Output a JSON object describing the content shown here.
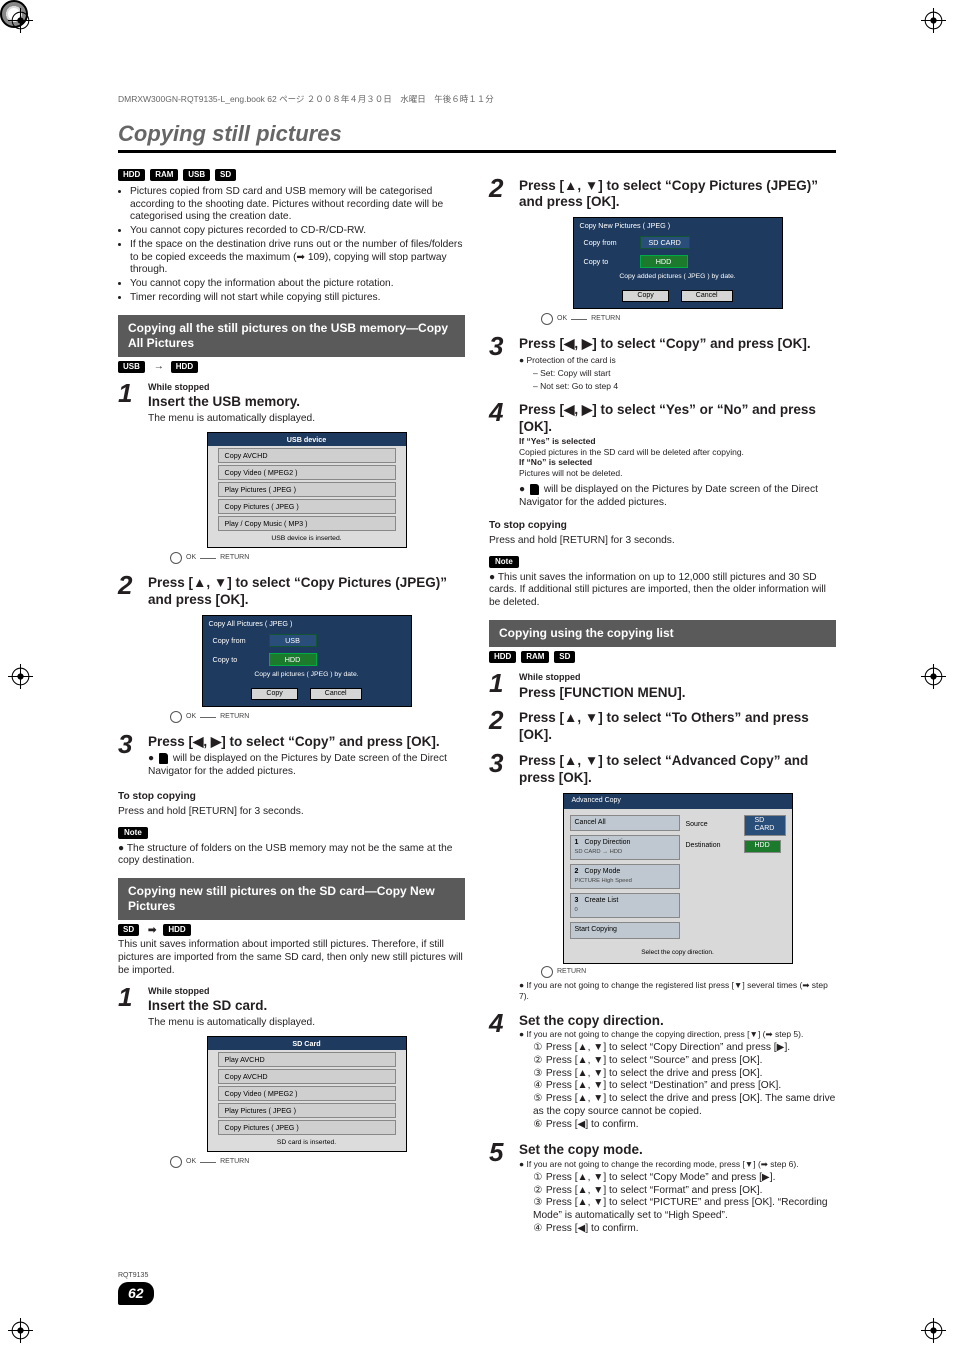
{
  "folio": "DMRXW300GN-RQT9135-L_eng.book  62 ページ  ２００８年４月３０日　水曜日　午後６時１１分",
  "page_number": "62",
  "rqt": "RQT9135",
  "title": "Copying still pictures",
  "media_badges": [
    "HDD",
    "RAM",
    "USB",
    "SD"
  ],
  "intro_bullets": [
    "Pictures copied from SD card and USB memory will be categorised according to the shooting date. Pictures without recording date will be categorised using the creation date.",
    "You cannot copy pictures recorded to CD-R/CD-RW.",
    "If the space on the destination drive runs out or the number of files/folders to be copied exceeds the maximum (➡ 109), copying will stop partway through.",
    "You cannot copy the information about the picture rotation.",
    "Timer recording will not start while copying still pictures."
  ],
  "section_a": {
    "heading": "Copying all the still pictures on the USB memory—Copy All Pictures",
    "path_from": "USB",
    "path_arrow": "→",
    "path_to": "HDD",
    "step1_lead": "While stopped",
    "step1_head": "Insert the USB memory.",
    "step1_sub": "The menu is automatically displayed.",
    "ui_usb": {
      "title": "USB device",
      "items": [
        "Copy AVCHD",
        "Copy Video ( MPEG2 )",
        "Play Pictures ( JPEG )",
        "Copy Pictures ( JPEG )",
        "Play / Copy Music ( MP3 )"
      ],
      "msg": "USB device is inserted.",
      "foot_ok": "OK",
      "foot_return": "RETURN"
    },
    "step2_head": "Press [▲, ▼] to select “Copy Pictures (JPEG)” and press [OK].",
    "ui_copyall": {
      "title": "Copy All Pictures ( JPEG )",
      "from_lbl": "Copy from",
      "from_val": "USB",
      "to_lbl": "Copy to",
      "to_val": "HDD",
      "msg": "Copy all pictures ( JPEG ) by date.",
      "btn_copy": "Copy",
      "btn_cancel": "Cancel",
      "foot_ok": "OK",
      "foot_return": "RETURN"
    },
    "step3_head": "Press [◀, ▶] to select “Copy” and press [OK].",
    "step3_note": "will be displayed on the Pictures by Date screen of the Direct Navigator for the added pictures.",
    "stop_head": "To stop copying",
    "stop_body": "Press and hold [RETURN] for 3 seconds.",
    "note_label": "Note",
    "note_text": "The structure of folders on the USB memory may not be the same at the copy destination."
  },
  "section_b": {
    "heading": "Copying new still pictures on the SD card—Copy New Pictures",
    "path_from": "SD",
    "path_arrow": "➡",
    "path_to": "HDD",
    "intro": "This unit saves information about imported still pictures. Therefore, if still pictures are imported from the same SD card, then only new still pictures will be imported.",
    "step1_lead": "While stopped",
    "step1_head": "Insert the SD card.",
    "step1_sub": "The menu is automatically displayed.",
    "ui_sd": {
      "title": "SD Card",
      "items": [
        "Play AVCHD",
        "Copy AVCHD",
        "Copy Video ( MPEG2 )",
        "Play Pictures ( JPEG )",
        "Copy Pictures ( JPEG )"
      ],
      "msg": "SD card is inserted.",
      "foot_ok": "OK",
      "foot_return": "RETURN"
    }
  },
  "col2": {
    "step2_head": "Press [▲, ▼] to select “Copy Pictures (JPEG)” and press [OK].",
    "ui_copynew": {
      "title": "Copy New Pictures ( JPEG )",
      "from_lbl": "Copy from",
      "from_val": "SD CARD",
      "to_lbl": "Copy to",
      "to_val": "HDD",
      "msg": "Copy added pictures ( JPEG ) by date.",
      "btn_copy": "Copy",
      "btn_cancel": "Cancel",
      "foot_ok": "OK",
      "foot_return": "RETURN"
    },
    "step3_head": "Press [◀, ▶] to select “Copy” and press [OK].",
    "step3_b1": "Protection of the card is",
    "step3_b1a": "– Set: Copy will start",
    "step3_b1b": "– Not set: Go to step 4",
    "step4_head": "Press [◀, ▶] to select “Yes” or “No” and press [OK].",
    "step4_yes_h": "If “Yes” is selected",
    "step4_yes_b": "Copied pictures in the SD card will be deleted after copying.",
    "step4_no_h": "If “No” is selected",
    "step4_no_b": "Pictures will not be deleted.",
    "step4_note": "will be displayed on the Pictures by Date screen of the Direct Navigator for the added pictures.",
    "stop_head": "To stop copying",
    "stop_body": "Press and hold [RETURN] for 3 seconds.",
    "note_label": "Note",
    "note_text": "This unit saves the information on up to 12,000 still pictures and 30 SD cards. If additional still pictures are imported, then the older information will be deleted.",
    "section_c": {
      "heading": "Copying using the copying list",
      "badges": [
        "HDD",
        "RAM",
        "SD"
      ],
      "step1_lead": "While stopped",
      "step1_head": "Press [FUNCTION MENU].",
      "step2_head": "Press [▲, ▼] to select “To Others” and press [OK].",
      "step3_head": "Press [▲, ▼] to select “Advanced Copy” and press [OK].",
      "ui_adv": {
        "title": "Advanced Copy",
        "cancel": "Cancel All",
        "rows": [
          {
            "n": "1",
            "t": "Copy Direction",
            "s": "SD CARD → HDD"
          },
          {
            "n": "2",
            "t": "Copy Mode",
            "s": "PICTURE   High Speed"
          },
          {
            "n": "3",
            "t": "Create List",
            "s": "0"
          },
          {
            "n": "",
            "t": "Start Copying",
            "s": ""
          }
        ],
        "src_lbl": "Source",
        "src_val": "SD CARD",
        "dst_lbl": "Destination",
        "dst_val": "HDD",
        "foot": "Select the copy direction.",
        "ret": "RETURN"
      },
      "after_ui": "If you are not going to change the registered list press [▼] several times (➡ step 7).",
      "step4_head": "Set the copy direction.",
      "step4_intro": "If you are not going to change the copying direction, press [▼] (➡ step 5).",
      "step4_items": [
        "Press [▲, ▼] to select “Copy Direction” and press [▶].",
        "Press [▲, ▼] to select “Source” and press [OK].",
        "Press [▲, ▼] to select the drive and press [OK].",
        "Press [▲, ▼] to select “Destination” and press [OK].",
        "Press [▲, ▼] to select the drive and press [OK]. The same drive as the copy source cannot be copied.",
        "Press [◀] to confirm."
      ],
      "step5_head": "Set the copy mode.",
      "step5_intro": "If you are not going to change the recording mode, press [▼] (➡ step 6).",
      "step5_items": [
        "Press [▲, ▼] to select “Copy Mode” and press [▶].",
        "Press [▲, ▼] to select “Format” and press [OK].",
        "Press [▲, ▼] to select “PICTURE” and press [OK]. “Recording Mode” is automatically set to “High Speed”.",
        "Press [◀] to confirm."
      ]
    }
  }
}
